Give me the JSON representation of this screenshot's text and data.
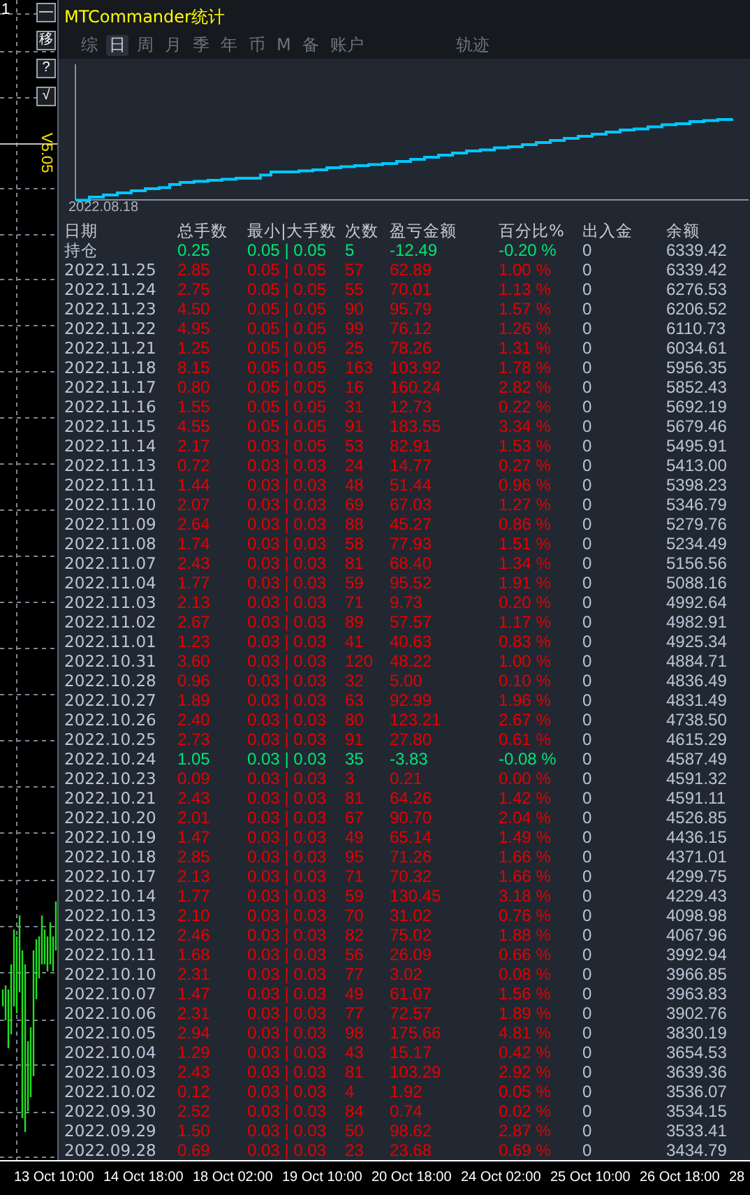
{
  "left_chart": {
    "top_label": "1",
    "version": "V5.05"
  },
  "side_buttons": [
    "—",
    "移",
    "?",
    "√"
  ],
  "window": {
    "title": "MTCommander统计"
  },
  "tabs": [
    {
      "label": "综",
      "selected": false
    },
    {
      "label": "日",
      "selected": true
    },
    {
      "label": "周",
      "selected": false
    },
    {
      "label": "月",
      "selected": false
    },
    {
      "label": "季",
      "selected": false
    },
    {
      "label": "年",
      "selected": false
    },
    {
      "label": "币",
      "selected": false
    },
    {
      "label": "M",
      "selected": false
    },
    {
      "label": "备",
      "selected": false
    },
    {
      "label": "账户",
      "selected": false
    },
    {
      "label": "轨迹",
      "selected": false
    }
  ],
  "equity_chart": {
    "start_label": "2022.08.18"
  },
  "table": {
    "columns": [
      "日期",
      "总手数",
      "最小|大手数",
      "次数",
      "盈亏金额",
      "百分比%",
      "出入金",
      "余额"
    ],
    "rows": [
      {
        "date": "持仓",
        "lots": "0.25",
        "minmax": "0.05 | 0.05",
        "count": "5",
        "pnl": "-12.49",
        "pct": "-0.20 %",
        "flow": "0",
        "balance": "6339.42",
        "kind": "loss"
      },
      {
        "date": "2022.11.25",
        "lots": "2.85",
        "minmax": "0.05 | 0.05",
        "count": "57",
        "pnl": "62.89",
        "pct": "1.00 %",
        "flow": "0",
        "balance": "6339.42",
        "kind": "profit"
      },
      {
        "date": "2022.11.24",
        "lots": "2.75",
        "minmax": "0.05 | 0.05",
        "count": "55",
        "pnl": "70.01",
        "pct": "1.13 %",
        "flow": "0",
        "balance": "6276.53",
        "kind": "profit"
      },
      {
        "date": "2022.11.23",
        "lots": "4.50",
        "minmax": "0.05 | 0.05",
        "count": "90",
        "pnl": "95.79",
        "pct": "1.57 %",
        "flow": "0",
        "balance": "6206.52",
        "kind": "profit"
      },
      {
        "date": "2022.11.22",
        "lots": "4.95",
        "minmax": "0.05 | 0.05",
        "count": "99",
        "pnl": "76.12",
        "pct": "1.26 %",
        "flow": "0",
        "balance": "6110.73",
        "kind": "profit"
      },
      {
        "date": "2022.11.21",
        "lots": "1.25",
        "minmax": "0.05 | 0.05",
        "count": "25",
        "pnl": "78.26",
        "pct": "1.31 %",
        "flow": "0",
        "balance": "6034.61",
        "kind": "profit"
      },
      {
        "date": "2022.11.18",
        "lots": "8.15",
        "minmax": "0.05 | 0.05",
        "count": "163",
        "pnl": "103.92",
        "pct": "1.78 %",
        "flow": "0",
        "balance": "5956.35",
        "kind": "profit"
      },
      {
        "date": "2022.11.17",
        "lots": "0.80",
        "minmax": "0.05 | 0.05",
        "count": "16",
        "pnl": "160.24",
        "pct": "2.82 %",
        "flow": "0",
        "balance": "5852.43",
        "kind": "profit"
      },
      {
        "date": "2022.11.16",
        "lots": "1.55",
        "minmax": "0.05 | 0.05",
        "count": "31",
        "pnl": "12.73",
        "pct": "0.22 %",
        "flow": "0",
        "balance": "5692.19",
        "kind": "profit"
      },
      {
        "date": "2022.11.15",
        "lots": "4.55",
        "minmax": "0.05 | 0.05",
        "count": "91",
        "pnl": "183.55",
        "pct": "3.34 %",
        "flow": "0",
        "balance": "5679.46",
        "kind": "profit"
      },
      {
        "date": "2022.11.14",
        "lots": "2.17",
        "minmax": "0.03 | 0.05",
        "count": "53",
        "pnl": "82.91",
        "pct": "1.53 %",
        "flow": "0",
        "balance": "5495.91",
        "kind": "profit"
      },
      {
        "date": "2022.11.13",
        "lots": "0.72",
        "minmax": "0.03 | 0.03",
        "count": "24",
        "pnl": "14.77",
        "pct": "0.27 %",
        "flow": "0",
        "balance": "5413.00",
        "kind": "profit"
      },
      {
        "date": "2022.11.11",
        "lots": "1.44",
        "minmax": "0.03 | 0.03",
        "count": "48",
        "pnl": "51.44",
        "pct": "0.96 %",
        "flow": "0",
        "balance": "5398.23",
        "kind": "profit"
      },
      {
        "date": "2022.11.10",
        "lots": "2.07",
        "minmax": "0.03 | 0.03",
        "count": "69",
        "pnl": "67.03",
        "pct": "1.27 %",
        "flow": "0",
        "balance": "5346.79",
        "kind": "profit"
      },
      {
        "date": "2022.11.09",
        "lots": "2.64",
        "minmax": "0.03 | 0.03",
        "count": "88",
        "pnl": "45.27",
        "pct": "0.86 %",
        "flow": "0",
        "balance": "5279.76",
        "kind": "profit"
      },
      {
        "date": "2022.11.08",
        "lots": "1.74",
        "minmax": "0.03 | 0.03",
        "count": "58",
        "pnl": "77.93",
        "pct": "1.51 %",
        "flow": "0",
        "balance": "5234.49",
        "kind": "profit"
      },
      {
        "date": "2022.11.07",
        "lots": "2.43",
        "minmax": "0.03 | 0.03",
        "count": "81",
        "pnl": "68.40",
        "pct": "1.34 %",
        "flow": "0",
        "balance": "5156.56",
        "kind": "profit"
      },
      {
        "date": "2022.11.04",
        "lots": "1.77",
        "minmax": "0.03 | 0.03",
        "count": "59",
        "pnl": "95.52",
        "pct": "1.91 %",
        "flow": "0",
        "balance": "5088.16",
        "kind": "profit"
      },
      {
        "date": "2022.11.03",
        "lots": "2.13",
        "minmax": "0.03 | 0.03",
        "count": "71",
        "pnl": "9.73",
        "pct": "0.20 %",
        "flow": "0",
        "balance": "4992.64",
        "kind": "profit"
      },
      {
        "date": "2022.11.02",
        "lots": "2.67",
        "minmax": "0.03 | 0.03",
        "count": "89",
        "pnl": "57.57",
        "pct": "1.17 %",
        "flow": "0",
        "balance": "4982.91",
        "kind": "profit"
      },
      {
        "date": "2022.11.01",
        "lots": "1.23",
        "minmax": "0.03 | 0.03",
        "count": "41",
        "pnl": "40.63",
        "pct": "0.83 %",
        "flow": "0",
        "balance": "4925.34",
        "kind": "profit"
      },
      {
        "date": "2022.10.31",
        "lots": "3.60",
        "minmax": "0.03 | 0.03",
        "count": "120",
        "pnl": "48.22",
        "pct": "1.00 %",
        "flow": "0",
        "balance": "4884.71",
        "kind": "profit"
      },
      {
        "date": "2022.10.28",
        "lots": "0.96",
        "minmax": "0.03 | 0.03",
        "count": "32",
        "pnl": "5.00",
        "pct": "0.10 %",
        "flow": "0",
        "balance": "4836.49",
        "kind": "profit"
      },
      {
        "date": "2022.10.27",
        "lots": "1.89",
        "minmax": "0.03 | 0.03",
        "count": "63",
        "pnl": "92.99",
        "pct": "1.96 %",
        "flow": "0",
        "balance": "4831.49",
        "kind": "profit"
      },
      {
        "date": "2022.10.26",
        "lots": "2.40",
        "minmax": "0.03 | 0.03",
        "count": "80",
        "pnl": "123.21",
        "pct": "2.67 %",
        "flow": "0",
        "balance": "4738.50",
        "kind": "profit"
      },
      {
        "date": "2022.10.25",
        "lots": "2.73",
        "minmax": "0.03 | 0.03",
        "count": "91",
        "pnl": "27.80",
        "pct": "0.61 %",
        "flow": "0",
        "balance": "4615.29",
        "kind": "profit"
      },
      {
        "date": "2022.10.24",
        "lots": "1.05",
        "minmax": "0.03 | 0.03",
        "count": "35",
        "pnl": "-3.83",
        "pct": "-0.08 %",
        "flow": "0",
        "balance": "4587.49",
        "kind": "loss"
      },
      {
        "date": "2022.10.23",
        "lots": "0.09",
        "minmax": "0.03 | 0.03",
        "count": "3",
        "pnl": "0.21",
        "pct": "0.00 %",
        "flow": "0",
        "balance": "4591.32",
        "kind": "profit"
      },
      {
        "date": "2022.10.21",
        "lots": "2.43",
        "minmax": "0.03 | 0.03",
        "count": "81",
        "pnl": "64.26",
        "pct": "1.42 %",
        "flow": "0",
        "balance": "4591.11",
        "kind": "profit"
      },
      {
        "date": "2022.10.20",
        "lots": "2.01",
        "minmax": "0.03 | 0.03",
        "count": "67",
        "pnl": "90.70",
        "pct": "2.04 %",
        "flow": "0",
        "balance": "4526.85",
        "kind": "profit"
      },
      {
        "date": "2022.10.19",
        "lots": "1.47",
        "minmax": "0.03 | 0.03",
        "count": "49",
        "pnl": "65.14",
        "pct": "1.49 %",
        "flow": "0",
        "balance": "4436.15",
        "kind": "profit"
      },
      {
        "date": "2022.10.18",
        "lots": "2.85",
        "minmax": "0.03 | 0.03",
        "count": "95",
        "pnl": "71.26",
        "pct": "1.66 %",
        "flow": "0",
        "balance": "4371.01",
        "kind": "profit"
      },
      {
        "date": "2022.10.17",
        "lots": "2.13",
        "minmax": "0.03 | 0.03",
        "count": "71",
        "pnl": "70.32",
        "pct": "1.66 %",
        "flow": "0",
        "balance": "4299.75",
        "kind": "profit"
      },
      {
        "date": "2022.10.14",
        "lots": "1.77",
        "minmax": "0.03 | 0.03",
        "count": "59",
        "pnl": "130.45",
        "pct": "3.18 %",
        "flow": "0",
        "balance": "4229.43",
        "kind": "profit"
      },
      {
        "date": "2022.10.13",
        "lots": "2.10",
        "minmax": "0.03 | 0.03",
        "count": "70",
        "pnl": "31.02",
        "pct": "0.76 %",
        "flow": "0",
        "balance": "4098.98",
        "kind": "profit"
      },
      {
        "date": "2022.10.12",
        "lots": "2.46",
        "minmax": "0.03 | 0.03",
        "count": "82",
        "pnl": "75.02",
        "pct": "1.88 %",
        "flow": "0",
        "balance": "4067.96",
        "kind": "profit"
      },
      {
        "date": "2022.10.11",
        "lots": "1.68",
        "minmax": "0.03 | 0.03",
        "count": "56",
        "pnl": "26.09",
        "pct": "0.66 %",
        "flow": "0",
        "balance": "3992.94",
        "kind": "profit"
      },
      {
        "date": "2022.10.10",
        "lots": "2.31",
        "minmax": "0.03 | 0.03",
        "count": "77",
        "pnl": "3.02",
        "pct": "0.08 %",
        "flow": "0",
        "balance": "3966.85",
        "kind": "profit"
      },
      {
        "date": "2022.10.07",
        "lots": "1.47",
        "minmax": "0.03 | 0.03",
        "count": "49",
        "pnl": "61.07",
        "pct": "1.56 %",
        "flow": "0",
        "balance": "3963.83",
        "kind": "profit"
      },
      {
        "date": "2022.10.06",
        "lots": "2.31",
        "minmax": "0.03 | 0.03",
        "count": "77",
        "pnl": "72.57",
        "pct": "1.89 %",
        "flow": "0",
        "balance": "3902.76",
        "kind": "profit"
      },
      {
        "date": "2022.10.05",
        "lots": "2.94",
        "minmax": "0.03 | 0.03",
        "count": "98",
        "pnl": "175.66",
        "pct": "4.81 %",
        "flow": "0",
        "balance": "3830.19",
        "kind": "profit"
      },
      {
        "date": "2022.10.04",
        "lots": "1.29",
        "minmax": "0.03 | 0.03",
        "count": "43",
        "pnl": "15.17",
        "pct": "0.42 %",
        "flow": "0",
        "balance": "3654.53",
        "kind": "profit"
      },
      {
        "date": "2022.10.03",
        "lots": "2.43",
        "minmax": "0.03 | 0.03",
        "count": "81",
        "pnl": "103.29",
        "pct": "2.92 %",
        "flow": "0",
        "balance": "3639.36",
        "kind": "profit"
      },
      {
        "date": "2022.10.02",
        "lots": "0.12",
        "minmax": "0.03 | 0.03",
        "count": "4",
        "pnl": "1.92",
        "pct": "0.05 %",
        "flow": "0",
        "balance": "3536.07",
        "kind": "profit"
      },
      {
        "date": "2022.09.30",
        "lots": "2.52",
        "minmax": "0.03 | 0.03",
        "count": "84",
        "pnl": "0.74",
        "pct": "0.02 %",
        "flow": "0",
        "balance": "3534.15",
        "kind": "profit"
      },
      {
        "date": "2022.09.29",
        "lots": "1.50",
        "minmax": "0.03 | 0.03",
        "count": "50",
        "pnl": "98.62",
        "pct": "2.87 %",
        "flow": "0",
        "balance": "3533.41",
        "kind": "profit"
      },
      {
        "date": "2022.09.28",
        "lots": "0.69",
        "minmax": "0.03 | 0.03",
        "count": "23",
        "pnl": "23.68",
        "pct": "0.69 %",
        "flow": "0",
        "balance": "3434.79",
        "kind": "profit"
      }
    ]
  },
  "time_axis": [
    "13 Oct 10:00",
    "14 Oct 18:00",
    "18 Oct 02:00",
    "19 Oct 10:00",
    "20 Oct 18:00",
    "24 Oct 02:00",
    "25 Oct 10:00",
    "26 Oct 18:00",
    "28"
  ]
}
